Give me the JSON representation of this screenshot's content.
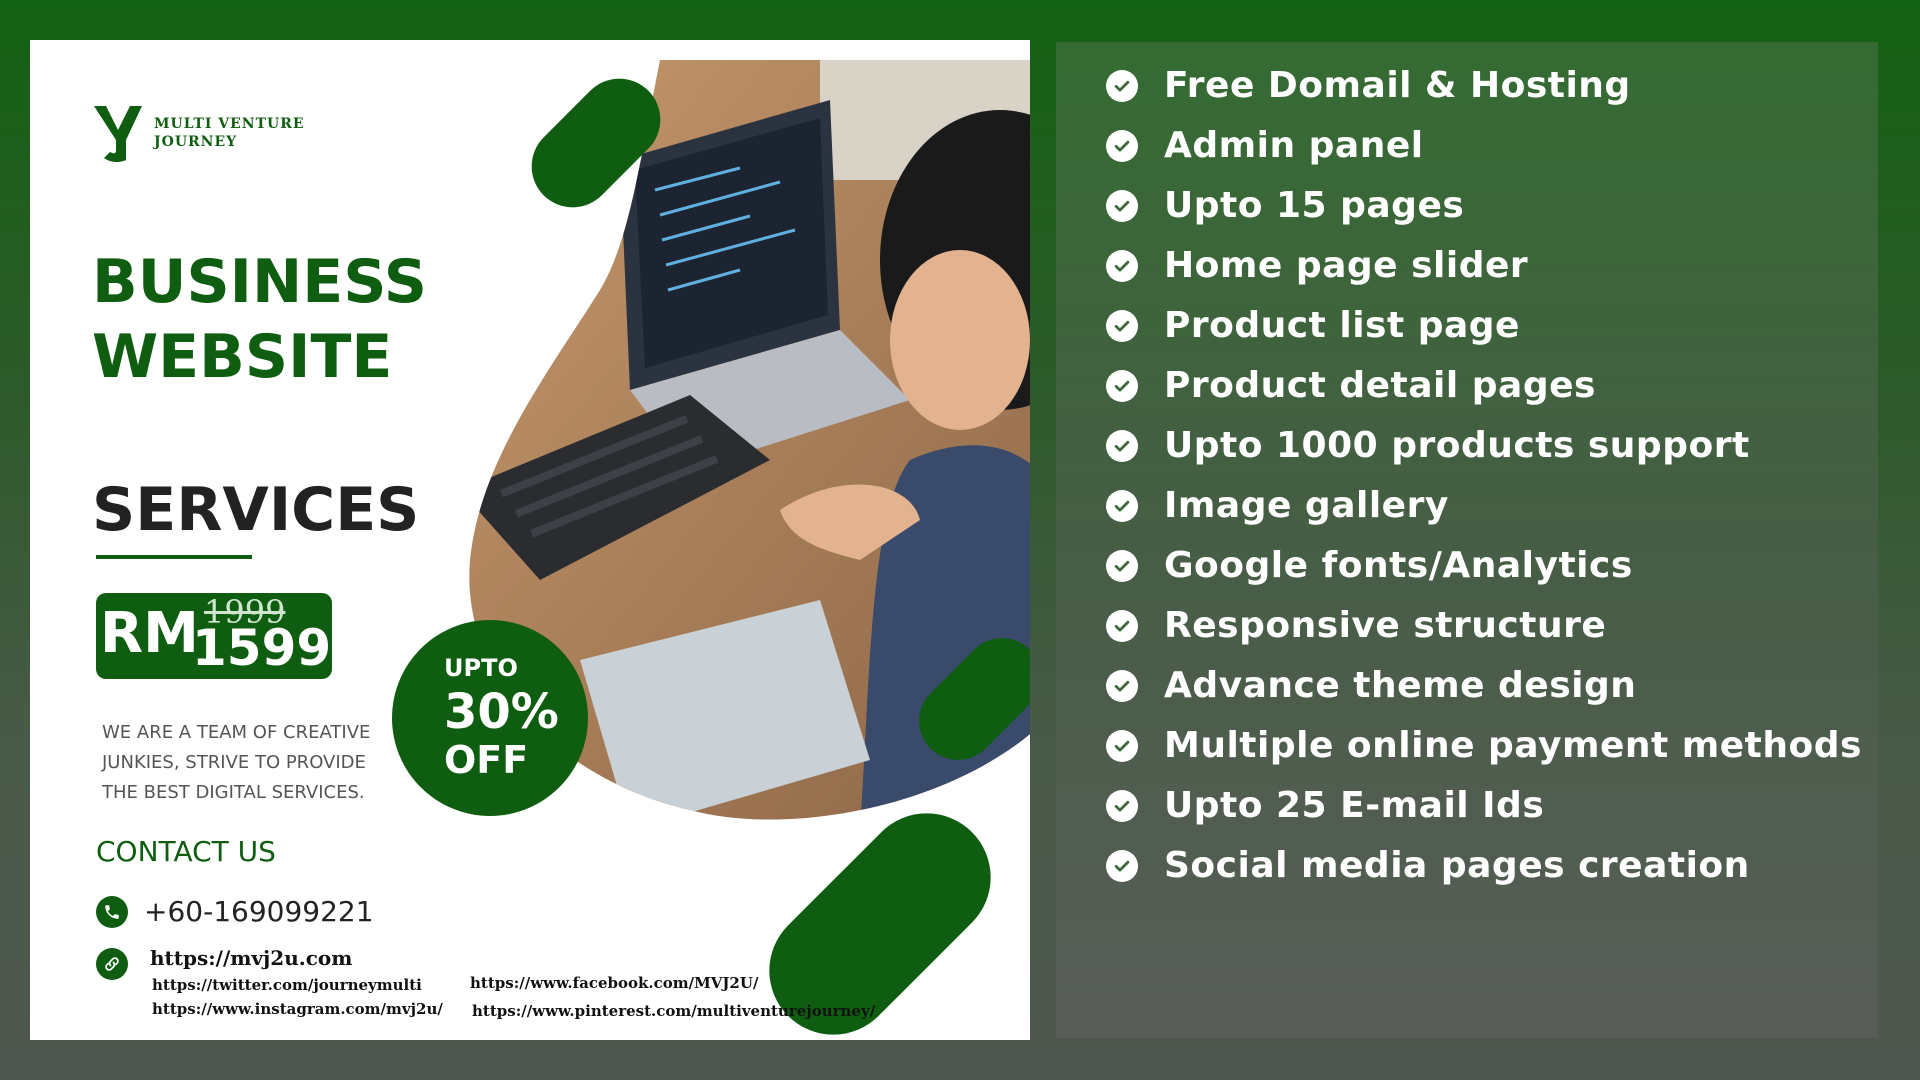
{
  "brand": {
    "name_line1": "MULTI VENTURE",
    "name_line2": "JOURNEY"
  },
  "title": {
    "line1": "BUSINESS",
    "line2": "WEBSITE",
    "line3": "SERVICES"
  },
  "price": {
    "currency": "RM",
    "old": "1999",
    "new": "1599"
  },
  "offer": {
    "upto": "UPTO",
    "percent": "30%",
    "off": "OFF"
  },
  "tagline": "WE ARE A TEAM OF CREATIVE JUNKIES, STRIVE TO PROVIDE THE BEST DIGITAL SERVICES.",
  "contact": {
    "heading": "CONTACT US",
    "phone": "+60-169099221",
    "website": "https://mvj2u.com",
    "twitter": "https://twitter.com/journeymulti",
    "instagram": "https://www.instagram.com/mvj2u/",
    "facebook": "https://www.facebook.com/MVJ2U/",
    "pinterest": "https://www.pinterest.com/multiventurejourney/"
  },
  "features": [
    "Free Domail & Hosting",
    "Admin panel",
    "Upto 15 pages",
    "Home page slider",
    "Product list page",
    "Product detail pages",
    "Upto 1000 products support",
    "Image gallery",
    "Google fonts/Analytics",
    "Responsive structure",
    "Advance theme design",
    "Multiple online payment methods",
    "Upto 25 E-mail Ids",
    "Social media pages creation"
  ],
  "colors": {
    "brand_green": "#0f5d10",
    "panel": "#465d45",
    "white": "#ffffff"
  },
  "icons": [
    "check-circle-icon",
    "phone-icon",
    "link-icon",
    "logo-mark-icon"
  ]
}
